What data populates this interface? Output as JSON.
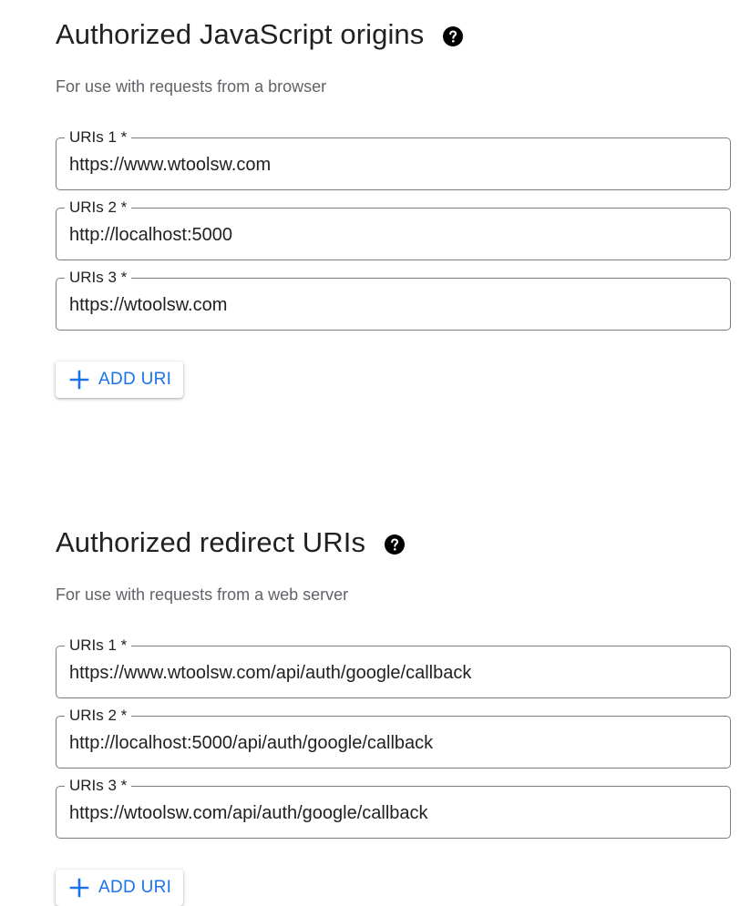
{
  "js_origins": {
    "title": "Authorized JavaScript origins",
    "description": "For use with requests from a browser",
    "fields": [
      {
        "label": "URIs 1 *",
        "value": "https://www.wtoolsw.com"
      },
      {
        "label": "URIs 2 *",
        "value": "http://localhost:5000"
      },
      {
        "label": "URIs 3 *",
        "value": "https://wtoolsw.com"
      }
    ],
    "add_button_label": "ADD URI"
  },
  "redirect_uris": {
    "title": "Authorized redirect URIs",
    "description": "For use with requests from a web server",
    "fields": [
      {
        "label": "URIs 1 *",
        "value": "https://www.wtoolsw.com/api/auth/google/callback"
      },
      {
        "label": "URIs 2 *",
        "value": "http://localhost:5000/api/auth/google/callback"
      },
      {
        "label": "URIs 3 *",
        "value": "https://wtoolsw.com/api/auth/google/callback"
      }
    ],
    "add_button_label": "ADD URI"
  },
  "icons": {
    "help": "help-circle-icon",
    "add": "plus-icon"
  },
  "colors": {
    "accent": "#1a73e8",
    "text": "#202124",
    "muted": "#5f6368",
    "border": "#7a7d81"
  }
}
